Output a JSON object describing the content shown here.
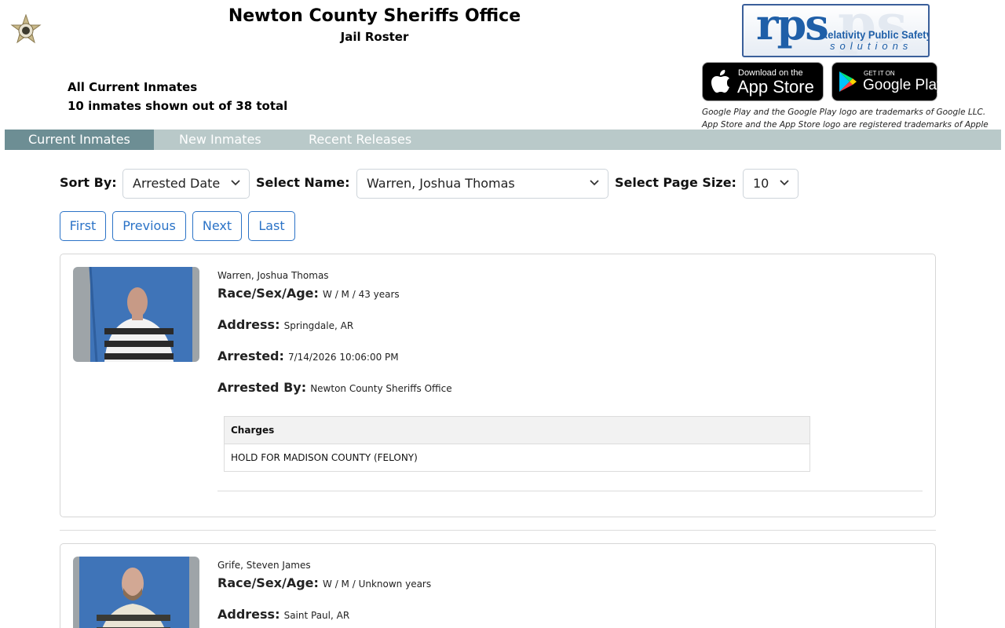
{
  "header": {
    "title": "Newton County Sheriffs Office",
    "subtitle": "Jail Roster",
    "badge_icon": "sheriff-star-badge-icon"
  },
  "summary": {
    "heading": "All Current Inmates",
    "count_text": "10 inmates shown out of 38 total"
  },
  "vendor": {
    "logo_text": "rps",
    "logo_line1": "Relativity Public Safety",
    "logo_line2": "solutions",
    "logo_color": "#1f5fa8"
  },
  "stores": {
    "apple_small": "Download on the",
    "apple_big": "App Store",
    "google_small": "GET IT ON",
    "google_big": "Google Play",
    "trademark_line1": "Google Play and the Google Play logo are trademarks of Google LLC.",
    "trademark_line2": "App Store and the App Store logo are registered trademarks of Apple"
  },
  "nav": {
    "tabs": [
      {
        "label": "Current Inmates",
        "active": true
      },
      {
        "label": "New Inmates",
        "active": false
      },
      {
        "label": "Recent Releases",
        "active": false
      }
    ],
    "bar_color": "#b9c9c9",
    "active_color": "#6d8e94"
  },
  "controls": {
    "sort_label": "Sort By:",
    "sort_value": "Arrested Date",
    "name_label": "Select Name:",
    "name_value": "Warren, Joshua Thomas",
    "size_label": "Select Page Size:",
    "size_value": "10"
  },
  "pager": {
    "first": "First",
    "previous": "Previous",
    "next": "Next",
    "last": "Last",
    "accent": "#2b73c7"
  },
  "labels": {
    "race_sex_age": "Race/Sex/Age:",
    "address": "Address:",
    "arrested": "Arrested:",
    "arrested_by": "Arrested By:",
    "charges": "Charges"
  },
  "inmates": [
    {
      "name": "Warren, Joshua Thomas",
      "race_sex_age": "W / M / 43 years",
      "address": "Springdale, AR",
      "arrested": "7/14/2026 10:06:00 PM",
      "arrested_by": "Newton County Sheriffs Office",
      "charges": [
        "HOLD FOR MADISON COUNTY (FELONY)"
      ]
    },
    {
      "name": "Grife, Steven James",
      "race_sex_age": "W / M / Unknown years",
      "address": "Saint Paul, AR"
    }
  ]
}
